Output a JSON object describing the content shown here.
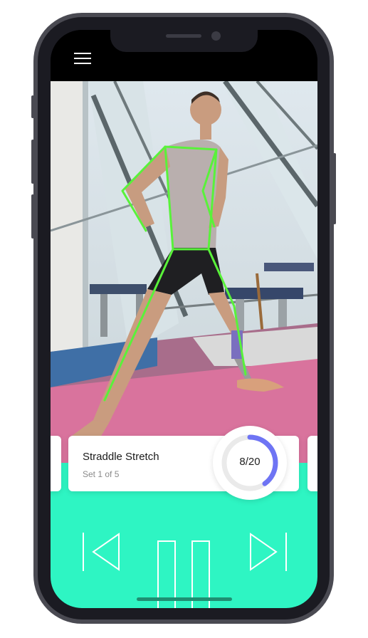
{
  "exercise": {
    "title": "Straddle Stretch",
    "set_label": "Set 1 of 5",
    "rep_count": "8/20",
    "progress": 0.4
  },
  "controls": {
    "previous": "skip-previous-icon",
    "pause": "pause-icon",
    "next": "skip-next-icon"
  },
  "colors": {
    "accent": "#2ef5c3",
    "progress_ring": "#6e74f4",
    "skeleton": "#59f23a"
  }
}
